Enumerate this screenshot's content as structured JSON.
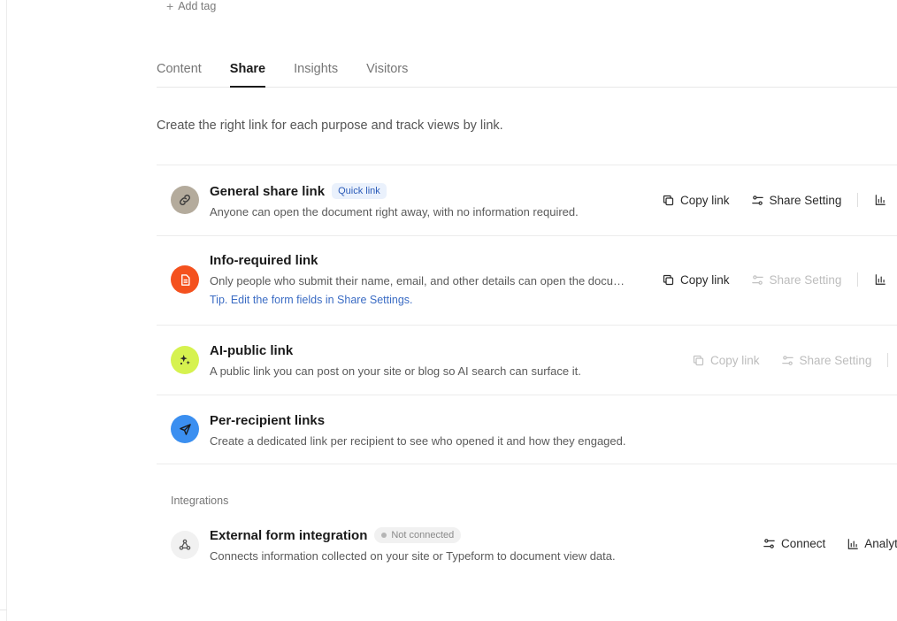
{
  "add_tag_label": "Add tag",
  "tabs": [
    {
      "label": "Content",
      "active": false
    },
    {
      "label": "Share",
      "active": true
    },
    {
      "label": "Insights",
      "active": false
    },
    {
      "label": "Visitors",
      "active": false
    }
  ],
  "description": "Create the right link for each purpose and track views by link.",
  "links": [
    {
      "title": "General share link",
      "pill": "Quick link",
      "subtitle": "Anyone can open the document right away, with no information required.",
      "icon": "link-icon",
      "icon_color": "#b4ab9c",
      "copy_label": "Copy link",
      "setting_label": "Share Setting"
    },
    {
      "title": "Info-required link",
      "subtitle": "Only people who submit their name, email, and other details can open the docu…",
      "tip": "Tip. Edit the form fields in Share Settings.",
      "icon": "document-icon",
      "icon_color": "#f4511e",
      "copy_label": "Copy link",
      "setting_label": "Share Setting"
    },
    {
      "title": "AI-public link",
      "subtitle": "A public link you can post on your site or blog so AI search can surface it.",
      "icon": "sparkle-icon",
      "icon_color": "#d6f24f",
      "copy_label": "Copy link",
      "setting_label": "Share Setting"
    },
    {
      "title": "Per-recipient links",
      "subtitle": "Create a dedicated link per recipient to see who opened it and how they engaged.",
      "icon": "send-icon",
      "icon_color": "#3b8ff0"
    }
  ],
  "integrations": {
    "label": "Integrations",
    "item": {
      "title": "External form integration",
      "status": "Not connected",
      "subtitle": "Connects information collected on your site or Typeform to document view data.",
      "icon": "webhook-icon",
      "icon_color": "#f1f1f1",
      "connect_label": "Connect",
      "analytics_label": "Analyt"
    }
  }
}
